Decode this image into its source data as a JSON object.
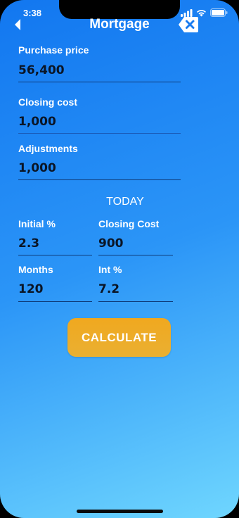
{
  "status": {
    "time": "3:38"
  },
  "nav": {
    "title": "Mortgage"
  },
  "fields": {
    "purchase_price": {
      "label": "Purchase price",
      "value": "56,400"
    },
    "closing_cost": {
      "label": "Closing cost",
      "value": "1,000"
    },
    "adjustments": {
      "label": "Adjustments",
      "value": "1,000"
    }
  },
  "today": {
    "title": "TODAY",
    "initial_pct": {
      "label": "Initial %",
      "value": "2.3"
    },
    "closing_cost": {
      "label": "Closing Cost",
      "value": "900"
    },
    "months": {
      "label": "Months",
      "value": "120"
    },
    "int_pct": {
      "label": "Int %",
      "value": "7.2"
    }
  },
  "calculate_label": "CALCULATE",
  "colors": {
    "background_top": "#1277f0",
    "background_bottom": "#6fd6fe",
    "button": "#f0a81f",
    "value_text": "#0a1526",
    "underline": "#0e3a78"
  }
}
